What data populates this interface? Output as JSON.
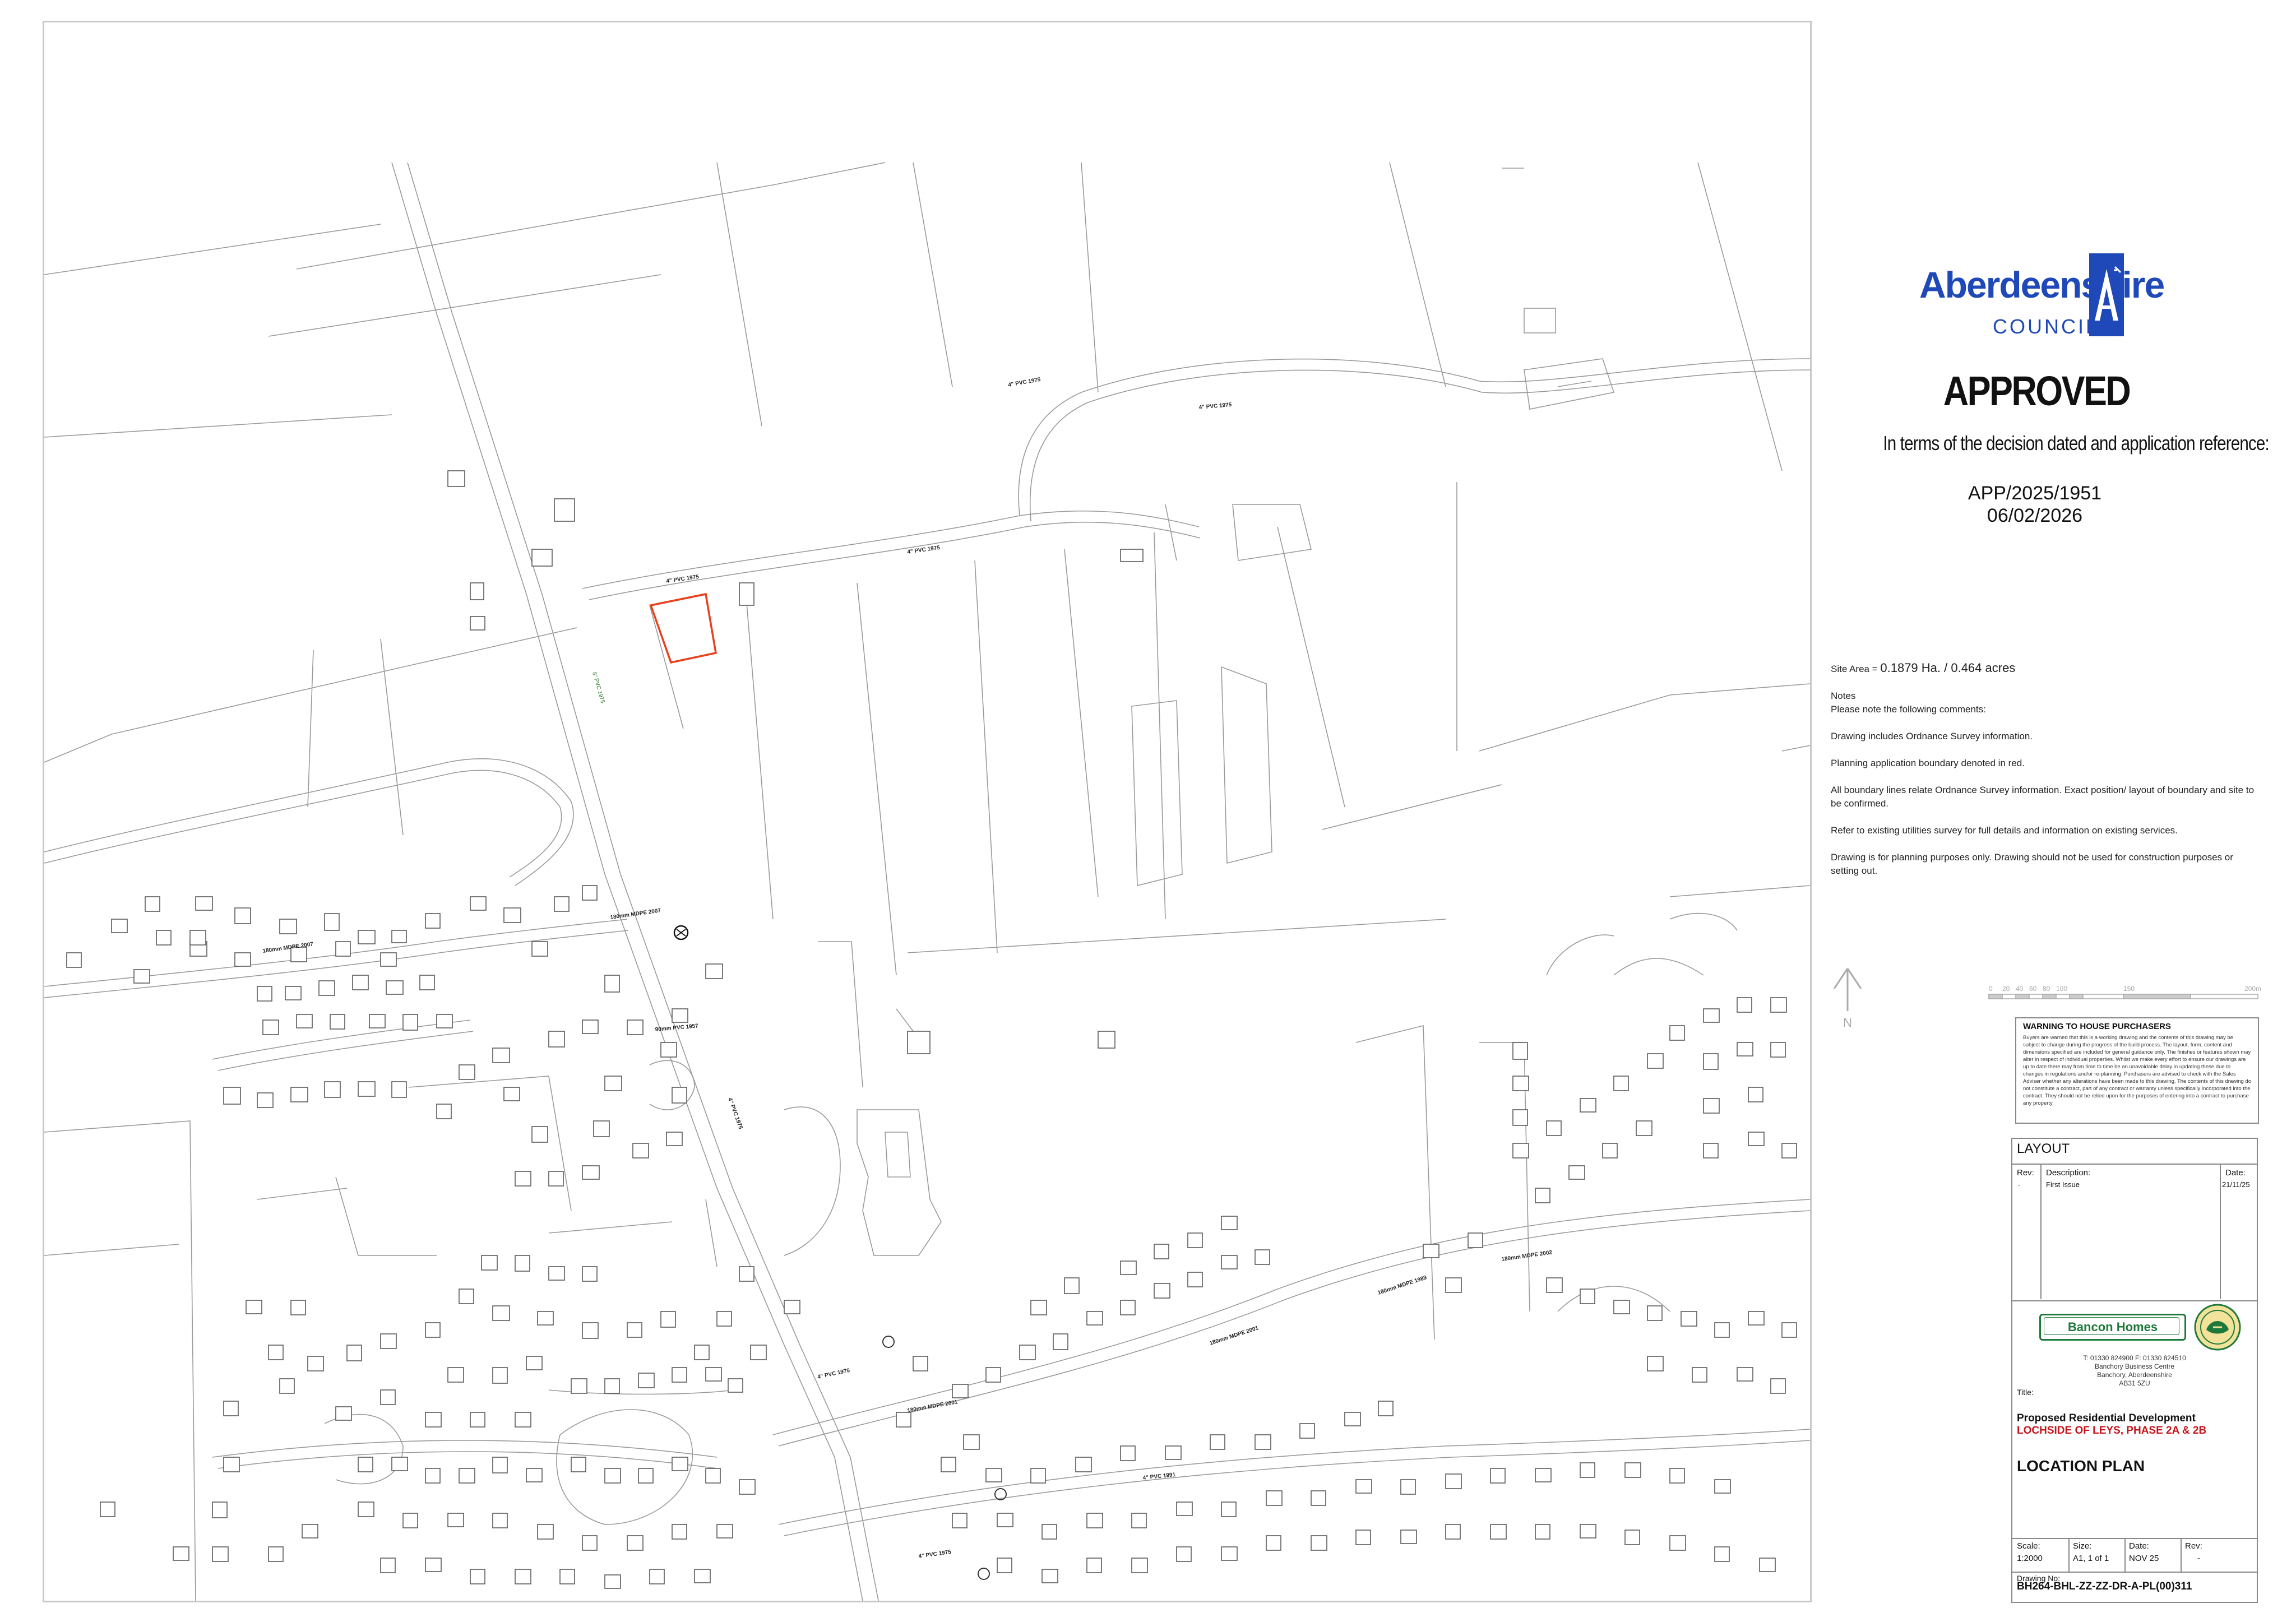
{
  "map": {
    "site_boundary_color": "#e8401c",
    "road_labels": [
      "4\" PVC 1975",
      "4\" PVC 1975",
      "4\" PVC 1975",
      "4\" PVC 1975",
      "180mm MDPE 2007",
      "180mm MDPE 2007",
      "90mm PVC 1957",
      "4\" PVC 1975",
      "180mm MDPE 2001",
      "180mm MDPE 2001",
      "180mm MDPE 2002",
      "4\" PVC 1975",
      "4\" PVC 1991",
      "4\" PVC 1975",
      "4\" PVC 1975",
      "180mm MDPE 1983"
    ],
    "green_label": "8\" PVC 1975"
  },
  "council": {
    "name": "Aberdeenshire",
    "sub": "COUNCIL",
    "brand_color": "#1f49b8"
  },
  "stamp": {
    "status": "APPROVED",
    "decision_text": "In terms of the decision dated and application reference:",
    "app_ref": "APP/2025/1951",
    "date": "06/02/2026"
  },
  "notes": {
    "site_area_label": "Site Area = ",
    "site_area_value": "0.1879 Ha. / 0.464 acres",
    "heading": "Notes",
    "intro": "Please note the following comments:",
    "items": [
      "Drawing includes Ordnance Survey information.",
      "Planning application boundary denoted in red.",
      "All boundary lines relate Ordnance Survey information. Exact position/ layout of boundary and site to be confirmed.",
      "Refer to existing utilities survey for full details and information on existing services.",
      "Drawing is for planning purposes only. Drawing should not be used for construction purposes or setting out."
    ]
  },
  "north_label": "N",
  "scale_ticks": [
    "0",
    "20",
    "40",
    "60",
    "80",
    "100",
    "150",
    "200m"
  ],
  "warning": {
    "title": "WARNING TO HOUSE PURCHASERS",
    "body": "Buyers are warned that this is a working drawing and the contents of this drawing may be subject to change during the progress of the build process. The layout, form, content and dimensions specified are included for general guidance only. The finishes or features shown may alter in respect of individual properties. Whilst we make every effort to ensure our drawings are up to date there may from time to time be an unavoidable delay in updating these due to changes in regulations and/or re-planning. Purchasers are advised to check with the Sales Adviser whether any alterations have been made to this drawing. The contents of this drawing do not constitute a contract, part of any contract or warranty unless specifically incorporated into the contract. They should not be relied upon for the purposes of entering into a contract to purchase any property."
  },
  "title_block": {
    "layout_label": "LAYOUT",
    "rev_header": "Rev:",
    "desc_header": "Description:",
    "date_header": "Date:",
    "rev_value": "-",
    "desc_value": "First Issue",
    "date_value": "21/11/25",
    "company": "Bancon Homes",
    "company_color": "#1e7a3a",
    "contact": [
      "T: 01330 824900  F: 01330 824510",
      "Banchory Business Centre",
      "Banchory, Aberdeenshire",
      "AB31 5ZU"
    ],
    "title_label": "Title:",
    "project_line1": "Proposed Residential Development",
    "project_line2": "LOCHSIDE OF LEYS, PHASE 2A & 2B",
    "project_line2_color": "#c4161c",
    "plan_title": "LOCATION PLAN",
    "scale_label": "Scale:",
    "scale_value": "1:2000",
    "size_label": "Size:",
    "size_value": "A1, 1 of 1",
    "date_label": "Date:",
    "date_val": "NOV 25",
    "rev_label": "Rev:",
    "rev_val": "-",
    "drawing_no_label": "Drawing No:",
    "drawing_no": "BH264-BHL-ZZ-ZZ-DR-A-PL(00)311"
  }
}
